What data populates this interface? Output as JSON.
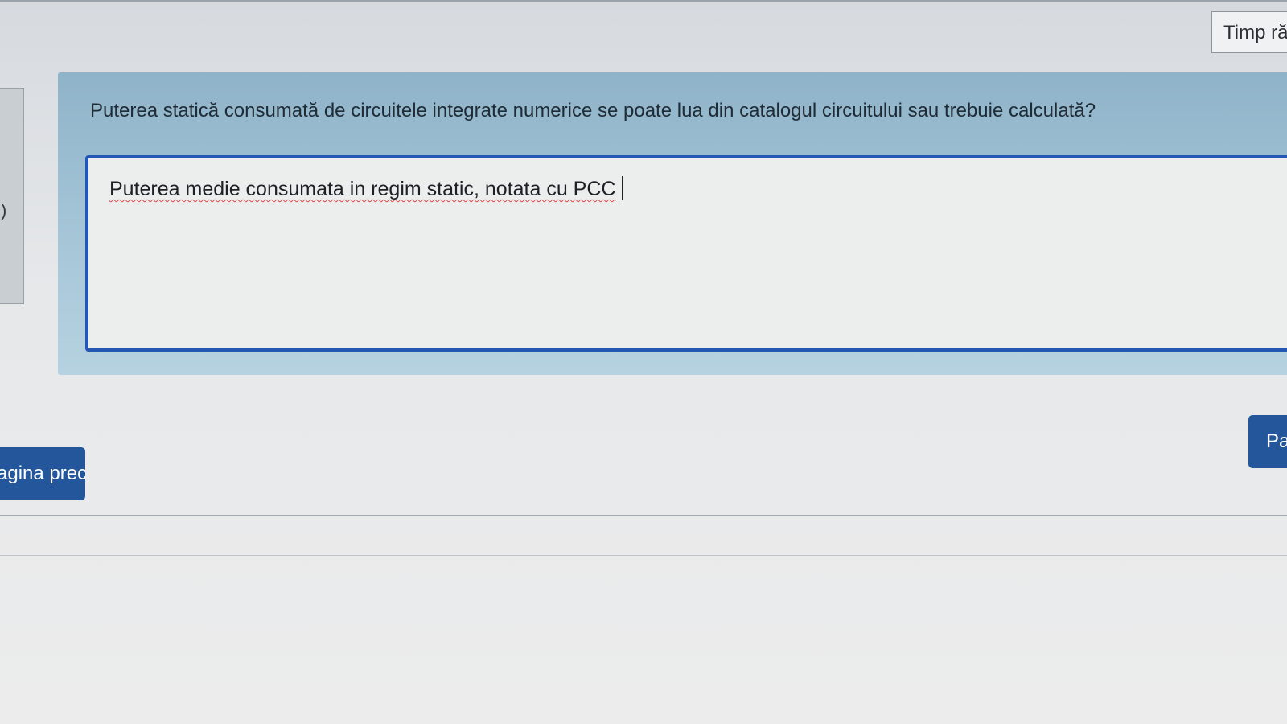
{
  "timer": {
    "label": "Timp ră"
  },
  "left_panel": {
    "mark": ")"
  },
  "question": {
    "text": "Puterea statică consumată de circuitele integrate numerice se poate lua din catalogul circuitului sau trebuie calculată?"
  },
  "answer": {
    "value": "Puterea medie consumata in regim static, notata cu PCC"
  },
  "navigation": {
    "prev_label": "Pagina precedentă",
    "next_label": "Pa"
  },
  "colors": {
    "accent": "#24569c",
    "answer_border": "#2456b3",
    "question_bg": "#a6c6d8"
  }
}
